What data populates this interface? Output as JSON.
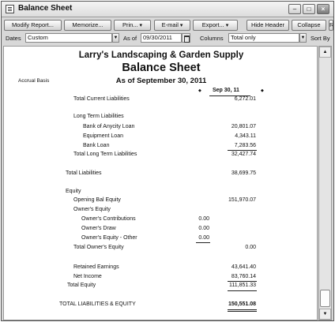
{
  "window": {
    "title": "Balance Sheet",
    "buttons": {
      "minimize": "–",
      "restore": "□",
      "close": "×"
    }
  },
  "toolbar": {
    "modify_report": "Modify Report...",
    "memorize": "Memorize...",
    "print": "Prin...",
    "email": "E-mail",
    "export": "Export...",
    "hide_header": "Hide Header",
    "collapse": "Collapse",
    "refresh": "Refresh"
  },
  "filters": {
    "dates_label": "Dates",
    "dates_value": "Custom",
    "as_of_label": "As of",
    "as_of_value": "09/30/2011",
    "columns_label": "Columns",
    "columns_value": "Total only",
    "sort_by_label": "Sort By"
  },
  "report": {
    "company": "Larry's Landscaping & Garden Supply",
    "title": "Balance Sheet",
    "basis": "Accrual Basis",
    "as_of": "As of September 30, 2011",
    "column_header": "Sep 30, 11",
    "rows": [
      {
        "label": "Total Current Liabilities",
        "amount": "6,272.01"
      },
      {
        "label": "Long Term Liabilities",
        "amount": ""
      },
      {
        "label": "Bank of Anycity Loan",
        "amount": "20,801.07"
      },
      {
        "label": "Equipment Loan",
        "amount": "4,343.11"
      },
      {
        "label": "Bank Loan",
        "amount": "7,283.56"
      },
      {
        "label": "Total Long Term Liabilities",
        "amount": "32,427.74"
      },
      {
        "label": "Total Liabilities",
        "amount": "38,699.75"
      },
      {
        "label": "Equity",
        "amount": ""
      },
      {
        "label": "Opening Bal Equity",
        "amount": "151,970.07"
      },
      {
        "label": "Owner's Equity",
        "amount": ""
      },
      {
        "label": "Owner's Contributions",
        "amount": "0.00"
      },
      {
        "label": "Owner's Draw",
        "amount": "0.00"
      },
      {
        "label": "Owner's Equity - Other",
        "amount": "0.00"
      },
      {
        "label": "Total Owner's Equity",
        "amount": "0.00"
      },
      {
        "label": "Retained Earnings",
        "amount": "43,641.40"
      },
      {
        "label": "Net Income",
        "amount": "83,760.14"
      },
      {
        "label": "Total Equity",
        "amount": "111,851.33"
      },
      {
        "label": "TOTAL LIABILITIES & EQUITY",
        "amount": "150,551.08"
      }
    ]
  },
  "icons": {
    "title": "report-icon",
    "calendar": "calendar-icon",
    "dropdown": "chevron-down-icon"
  }
}
